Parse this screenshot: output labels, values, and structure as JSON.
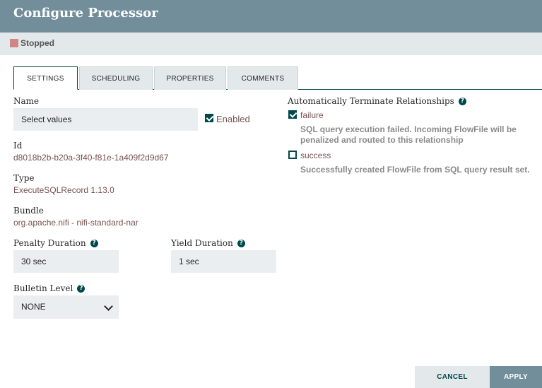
{
  "dialog": {
    "title": "Configure Processor"
  },
  "status": {
    "text": "Stopped",
    "color": "#d18686"
  },
  "tabs": [
    {
      "label": "SETTINGS",
      "active": true
    },
    {
      "label": "SCHEDULING",
      "active": false
    },
    {
      "label": "PROPERTIES",
      "active": false
    },
    {
      "label": "COMMENTS",
      "active": false
    }
  ],
  "settings": {
    "name_label": "Name",
    "name_value": "Select values",
    "enabled_label": "Enabled",
    "enabled": true,
    "id_label": "Id",
    "id_value": "d8018b2b-b20a-3f40-f81e-1a409f2d9d67",
    "type_label": "Type",
    "type_value": "ExecuteSQLRecord 1.13.0",
    "bundle_label": "Bundle",
    "bundle_value": "org.apache.nifi - nifi-standard-nar",
    "penalty_label": "Penalty Duration",
    "penalty_value": "30 sec",
    "yield_label": "Yield Duration",
    "yield_value": "1 sec",
    "bulletin_label": "Bulletin Level",
    "bulletin_value": "NONE"
  },
  "relationships": {
    "title": "Automatically Terminate Relationships",
    "items": [
      {
        "name": "failure",
        "checked": true,
        "desc": "SQL query execution failed. Incoming FlowFile will be penalized and routed to this relationship"
      },
      {
        "name": "success",
        "checked": false,
        "desc": "Successfully created FlowFile from SQL query result set."
      }
    ]
  },
  "buttons": {
    "cancel": "CANCEL",
    "apply": "APPLY"
  },
  "colors": {
    "header": "#728e9b",
    "accent": "#004849",
    "value": "#775351",
    "field_bg": "#eaeef0"
  },
  "icons": {
    "help": "question-circle-icon",
    "status": "stopped-square-icon",
    "dropdown": "chevron-down-icon"
  }
}
